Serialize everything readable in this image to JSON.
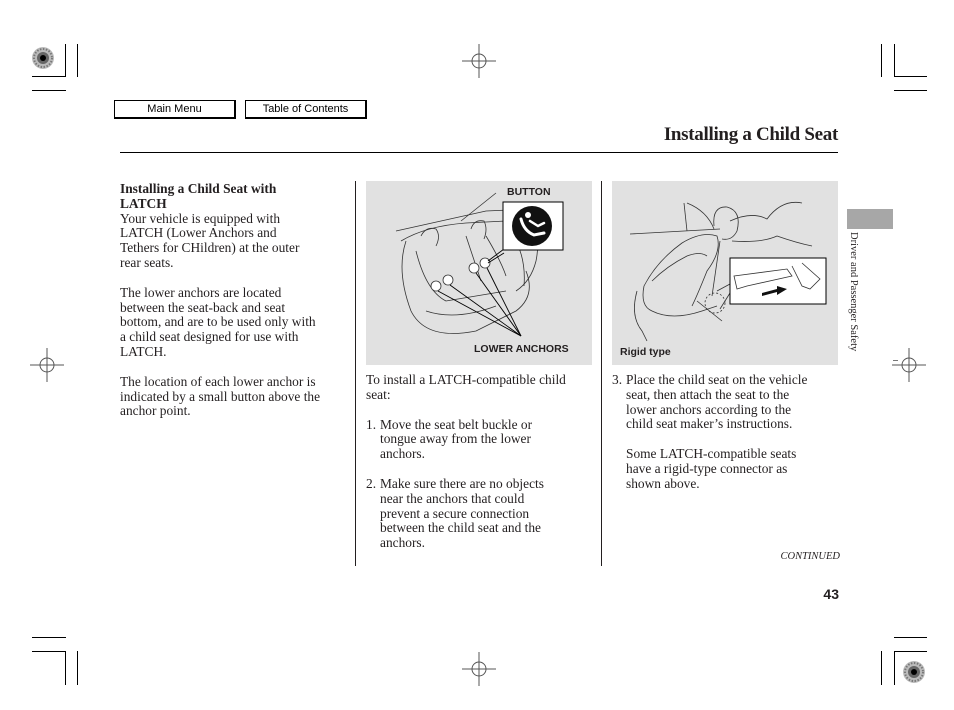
{
  "nav": {
    "main_menu": "Main Menu",
    "table_of_contents": "Table of Contents"
  },
  "header": {
    "title": "Installing a Child Seat"
  },
  "column1": {
    "heading_line1": "Installing a Child Seat with",
    "heading_line2": "LATCH",
    "para1": [
      "Your vehicle is equipped with",
      "LATCH (Lower Anchors and",
      "Tethers for CHildren) at the outer",
      "rear seats."
    ],
    "para2": [
      "The lower anchors are located",
      "between the seat-back and seat",
      "bottom, and are to be used only with",
      "a child seat designed for use with",
      "LATCH."
    ],
    "para3": [
      "The location of each lower anchor is",
      "indicated by a small button above the",
      "anchor point."
    ]
  },
  "figure1": {
    "label_button": "BUTTON",
    "label_anchors": "LOWER ANCHORS",
    "icon": "child-seat-icon"
  },
  "figure2": {
    "label": "Rigid type"
  },
  "column2": {
    "intro": [
      "To install a LATCH-compatible child",
      "seat:"
    ],
    "steps": [
      {
        "num": "1.",
        "lines": [
          "Move the seat belt buckle or",
          "tongue away from the lower",
          "anchors."
        ]
      },
      {
        "num": "2.",
        "lines": [
          "Make sure there are no objects",
          "near the anchors that could",
          "prevent a secure connection",
          "between the child seat and the",
          "anchors."
        ]
      }
    ]
  },
  "column3": {
    "step": {
      "num": "3.",
      "lines": [
        "Place the child seat on the vehicle",
        "seat, then attach the seat to the",
        "lower anchors according to the",
        "child seat maker’s instructions."
      ]
    },
    "note": [
      "Some LATCH-compatible seats",
      "have a rigid-type connector as",
      "shown above."
    ]
  },
  "sidebar": {
    "section": "Driver and Passenger Safety",
    "tab_color": "#a7a7a7"
  },
  "footer": {
    "continued": "CONTINUED",
    "page_number": "43"
  }
}
